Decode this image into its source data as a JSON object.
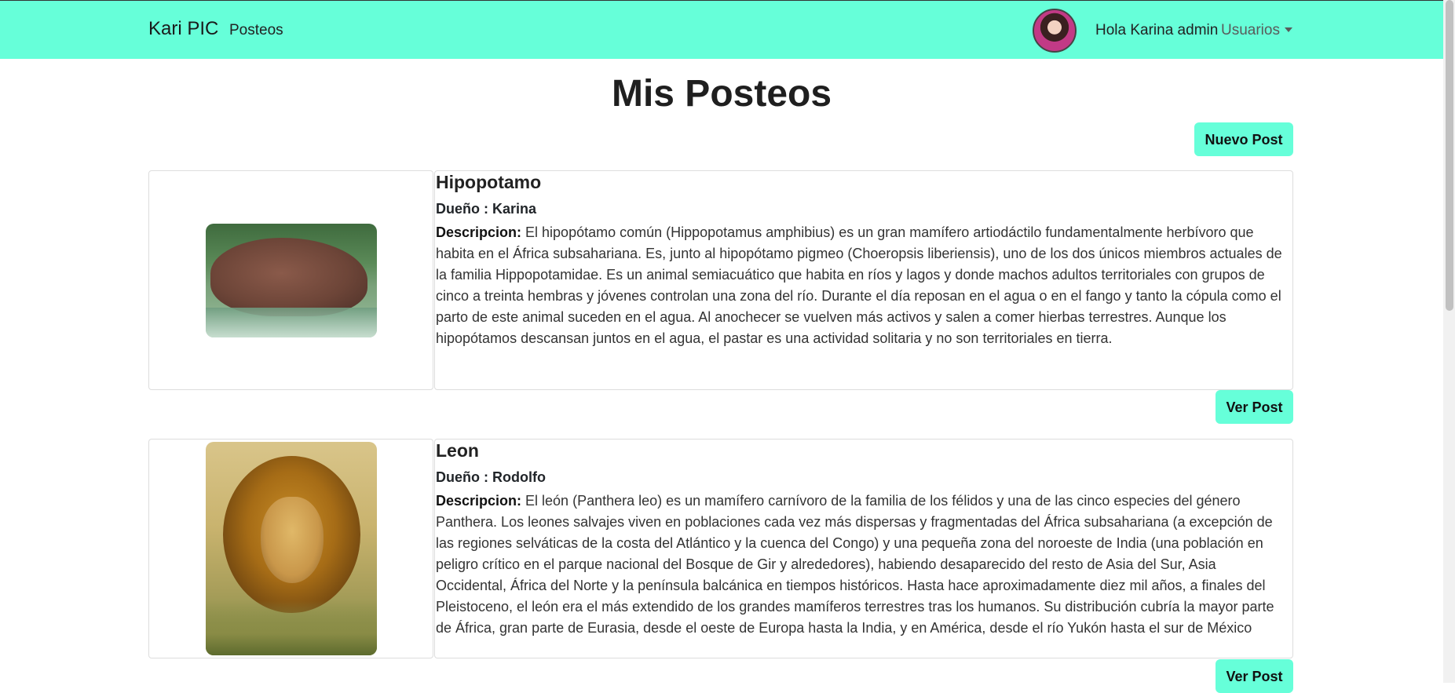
{
  "navbar": {
    "brand": "Kari PIC",
    "link": "Posteos",
    "greeting": "Hola Karina admin",
    "users_menu": "Usuarios",
    "accent": "#66ffd9"
  },
  "page": {
    "title": "Mis Posteos",
    "new_post_label": "Nuevo Post"
  },
  "posts": [
    {
      "title": "Hipopotamo",
      "owner": "Dueño : Karina",
      "desc_label": "Descripcion:",
      "description": " El hipopótamo común (Hippopotamus amphibius) es un gran mamífero artiodáctilo fundamentalmente herbívoro que habita en el África subsahariana. Es, junto al hipopótamo pigmeo (Choeropsis liberiensis), uno de los dos únicos miembros actuales de la familia Hippopotamidae. Es un animal semiacuático que habita en ríos y lagos y donde machos adultos territoriales con grupos de cinco a treinta hembras y jóvenes controlan una zona del río. Durante el día reposan en el agua o en el fango y tanto la cópula como el parto de este animal suceden en el agua. Al anochecer se vuelven más activos y salen a comer hierbas terrestres. Aunque los hipopótamos descansan juntos en el agua, el pastar es una actividad solitaria y no son territoriales en tierra.",
      "view_label": "Ver Post"
    },
    {
      "title": "Leon",
      "owner": "Dueño : Rodolfo",
      "desc_label": "Descripcion:",
      "description": " El león (Panthera leo) es un mamífero carnívoro de la familia de los félidos y una de las cinco especies del género Panthera. Los leones salvajes viven en poblaciones cada vez más dispersas y fragmentadas del África subsahariana (a excepción de las regiones selváticas de la costa del Atlántico y la cuenca del Congo) y una pequeña zona del noroeste de India (una población en peligro crítico en el parque nacional del Bosque de Gir y alrededores), habiendo desaparecido del resto de Asia del Sur, Asia Occidental, África del Norte y la península balcánica en tiempos históricos. Hasta hace aproximadamente diez mil años, a finales del Pleistoceno, el león era el más extendido de los grandes mamíferos terrestres tras los humanos. Su distribución cubría la mayor parte de África, gran parte de Eurasia, desde el oeste de Europa hasta la India, y en América, desde el río Yukón hasta el sur de México",
      "view_label": "Ver Post"
    }
  ]
}
